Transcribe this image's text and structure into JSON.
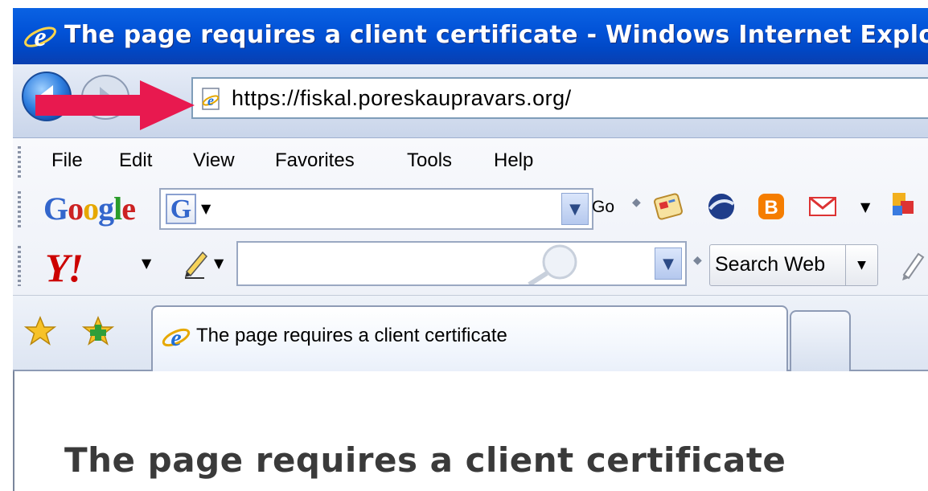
{
  "window": {
    "title": "The page requires a client certificate - Windows Internet Explorer",
    "icon": "ie-logo-icon"
  },
  "navigation": {
    "back_icon": "back-arrow-icon",
    "forward_icon": "forward-arrow-icon",
    "address": "https://fiskal.poreskaupravars.org/",
    "annotation": "red-arrow-icon",
    "annotation_color": "#e8194f"
  },
  "menubar": {
    "items": [
      "File",
      "Edit",
      "View",
      "Favorites",
      "Tools",
      "Help"
    ]
  },
  "google_toolbar": {
    "logo": "Google",
    "search_value": "",
    "go_label": "Go",
    "icons": [
      "news-icon",
      "google-earth-icon",
      "blogger-icon",
      "gmail-icon",
      "more-icon"
    ]
  },
  "yahoo_toolbar": {
    "logo": "Y!",
    "search_value": "",
    "search_web_label": "Search Web"
  },
  "tabs": {
    "active_label": "The page requires a client certificate"
  },
  "content": {
    "heading": "The page requires a client certificate"
  },
  "colors": {
    "titlebar": "#0253d8",
    "google_blue": "#3366cc",
    "yahoo_red": "#cc0000"
  }
}
